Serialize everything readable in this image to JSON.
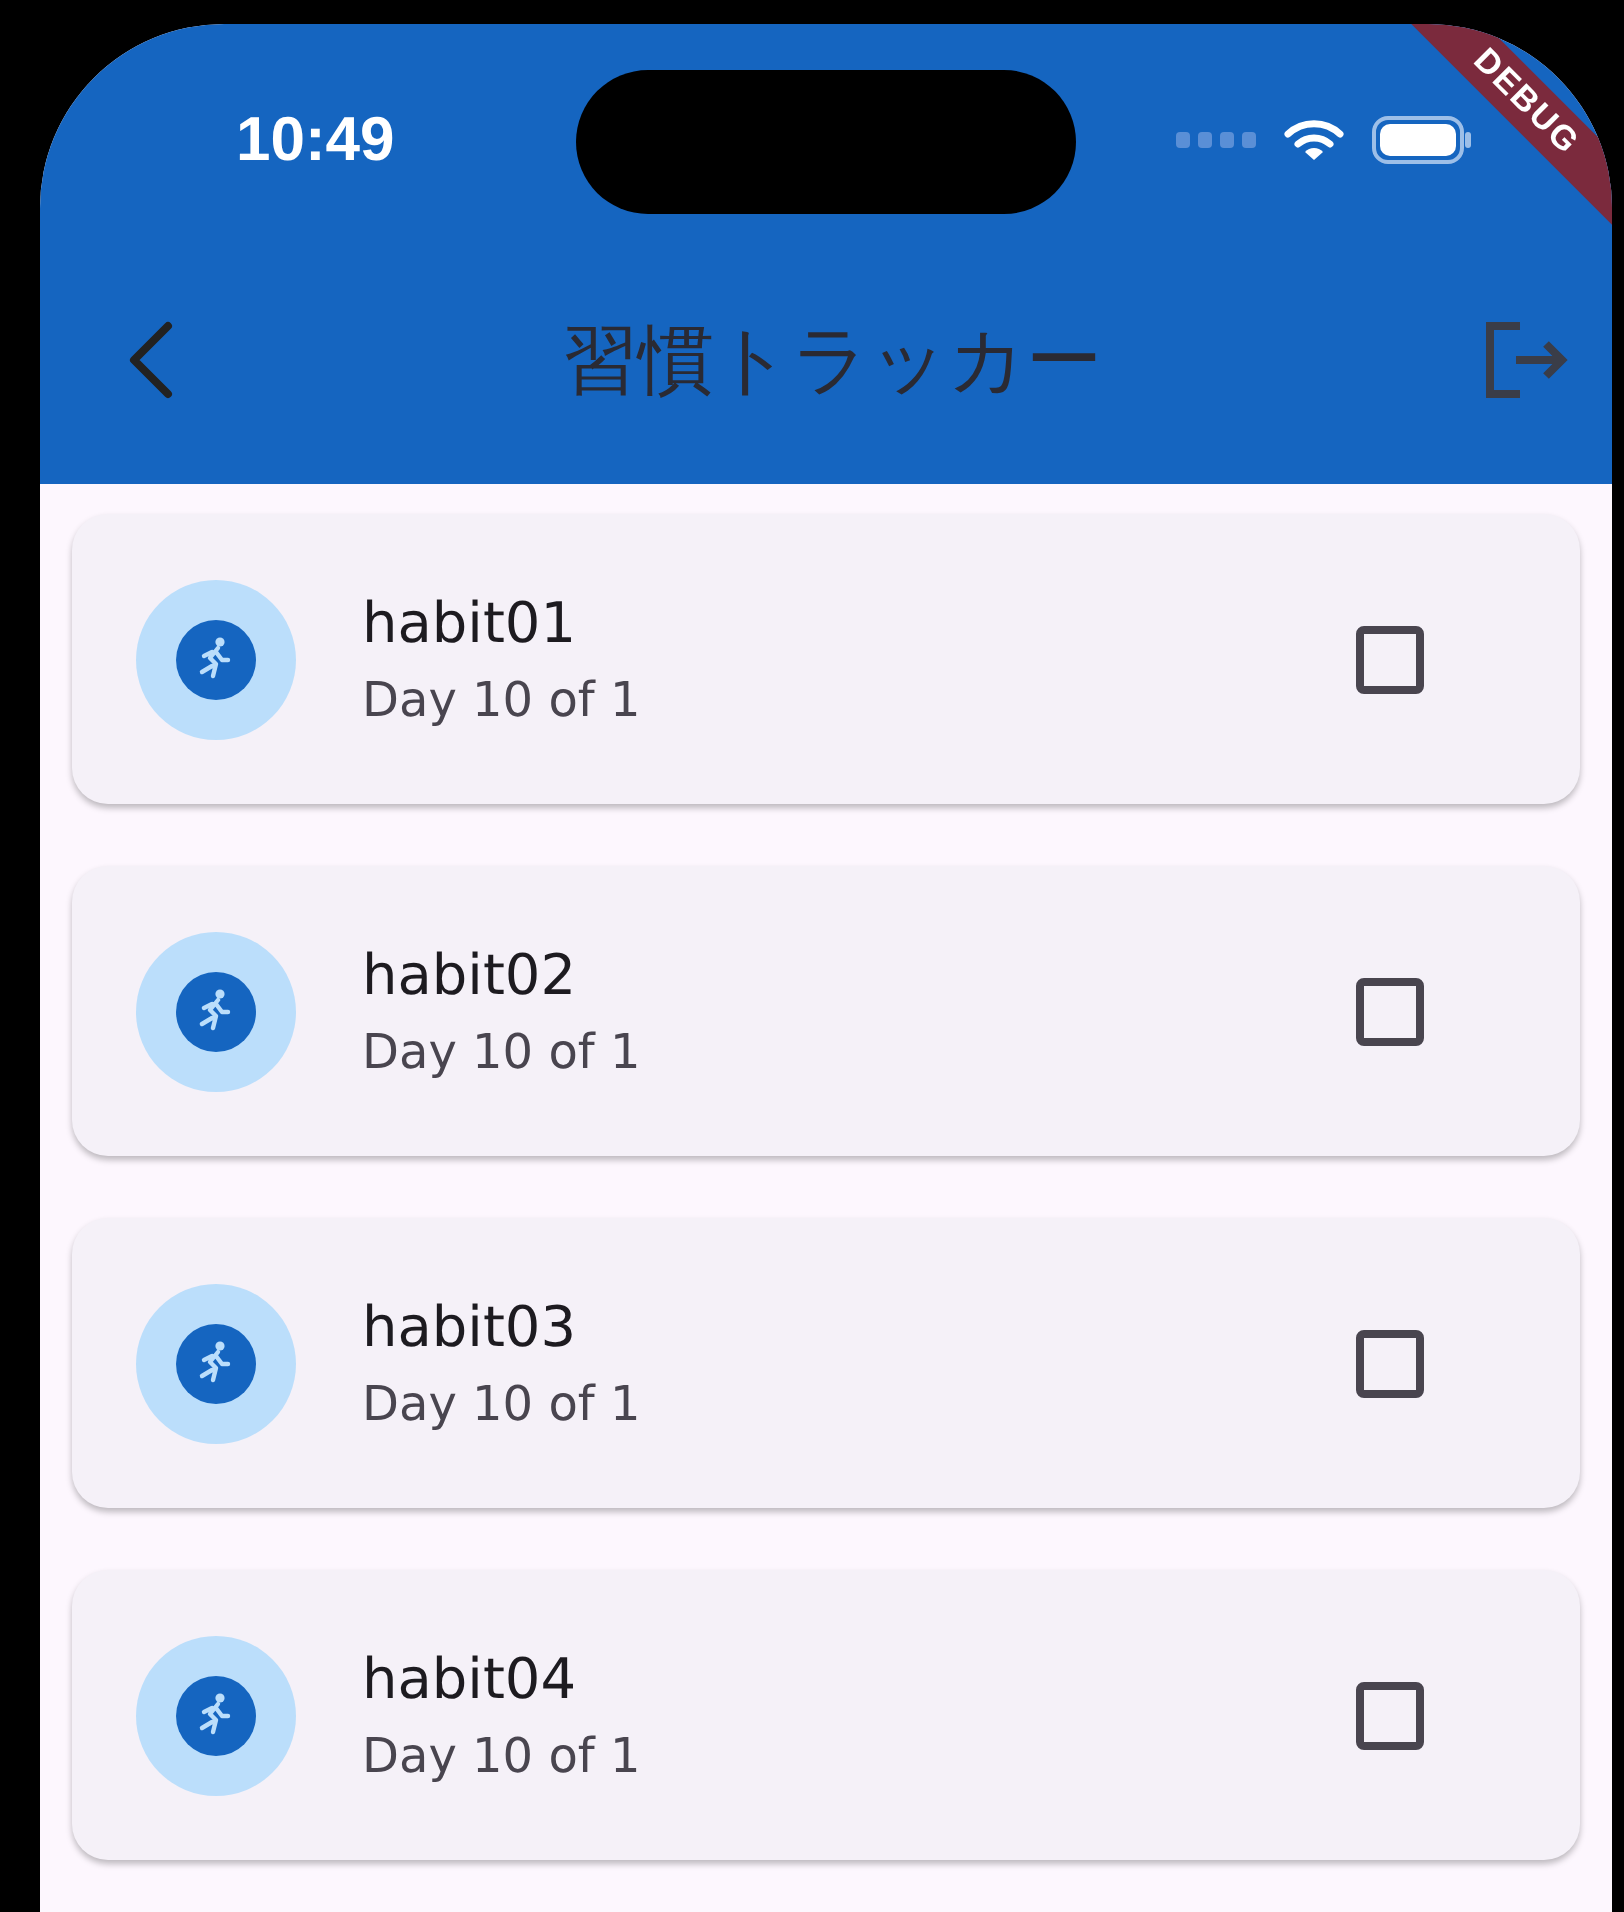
{
  "status_bar": {
    "time": "10:49"
  },
  "debug_banner": "DEBUG",
  "app_bar": {
    "title": "習慣トラッカー"
  },
  "habits": [
    {
      "name": "habit01",
      "progress": "Day 10 of 1",
      "checked": false
    },
    {
      "name": "habit02",
      "progress": "Day 10 of 1",
      "checked": false
    },
    {
      "name": "habit03",
      "progress": "Day 10 of 1",
      "checked": false
    },
    {
      "name": "habit04",
      "progress": "Day 10 of 1",
      "checked": false
    }
  ]
}
